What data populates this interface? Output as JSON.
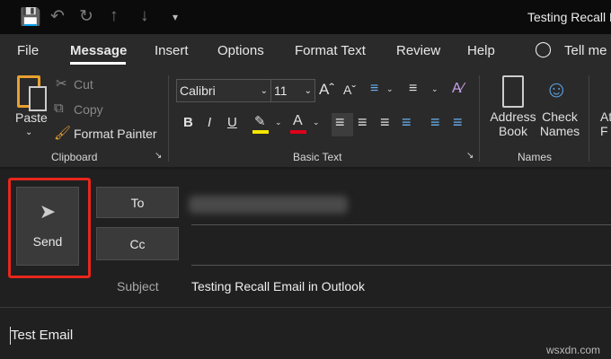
{
  "window": {
    "title": "Testing Recall Em"
  },
  "quick_access": {
    "save": "save-icon",
    "undo": "undo-icon",
    "redo": "redo-icon",
    "up": "up-arrow-icon",
    "down": "down-arrow-icon",
    "customize": "customize-icon"
  },
  "tabs": [
    "File",
    "Message",
    "Insert",
    "Options",
    "Format Text",
    "Review",
    "Help"
  ],
  "tell_me": "Tell me",
  "ribbon": {
    "clipboard": {
      "paste": "Paste",
      "cut": "Cut",
      "copy": "Copy",
      "format_painter": "Format Painter",
      "label": "Clipboard"
    },
    "basic_text": {
      "font": "Calibri",
      "size": "11",
      "bold": "B",
      "italic": "I",
      "underline": "U",
      "label": "Basic Text",
      "highlight_color": "#f5e600",
      "font_color": "#e0001a"
    },
    "names": {
      "address_book": [
        "Address",
        "Book"
      ],
      "check_names": [
        "Check",
        "Names"
      ],
      "label": "Names"
    },
    "partial": [
      "At",
      "F"
    ]
  },
  "compose": {
    "send": "Send",
    "to": "To",
    "cc": "Cc",
    "subject_label": "Subject",
    "subject": "Testing Recall Email in Outlook",
    "body": "Test Email",
    "highlight_color": "#e8261c"
  },
  "watermark": "wsxdn.com"
}
